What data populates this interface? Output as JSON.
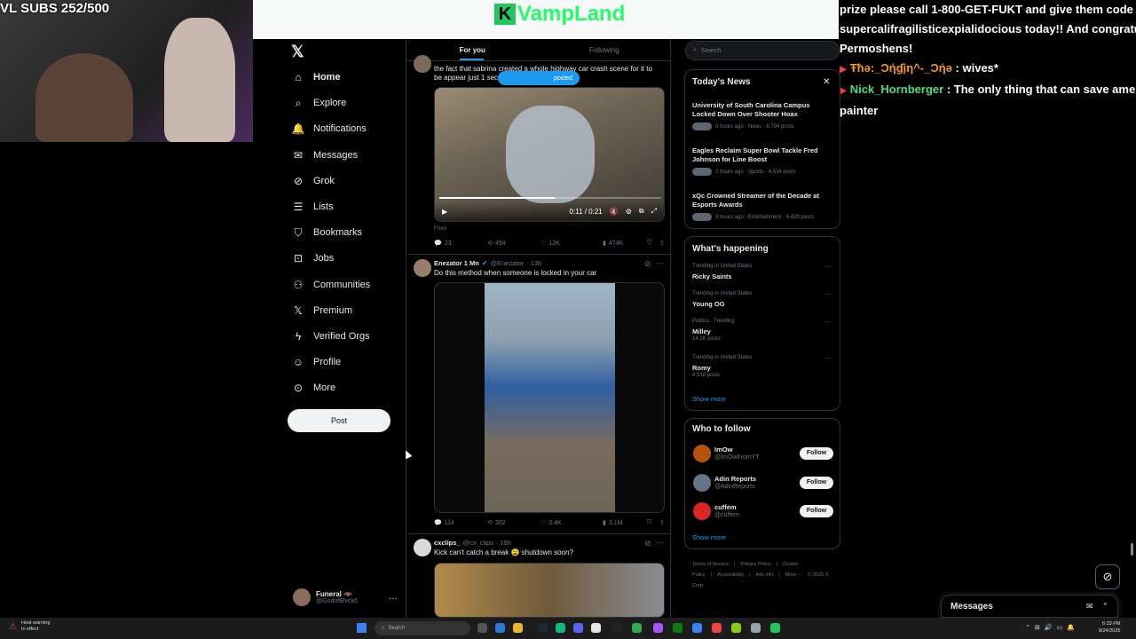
{
  "overlay": {
    "subs_counter": "VL SUBS 252/500",
    "brand_letter": "K",
    "brand_name": "VampLand",
    "chat": [
      {
        "user": "",
        "text": "prize please call 1-800-GET-FUKT and give them code"
      },
      {
        "user": "",
        "text": "supercalifragilisticexpialidocious today!! And congratulation"
      },
      {
        "user": "",
        "text": "Permoshens!"
      },
      {
        "user": "Ŧħə:_Ɔήɠįη^-_Ɔήə",
        "text": ": wives*"
      },
      {
        "user": "Nick_Hornberger",
        "text": ": The only thing that can save america i"
      },
      {
        "user": "",
        "text": "painter"
      }
    ]
  },
  "nav": {
    "logo": "𝕏",
    "items": [
      {
        "label": "Home",
        "icon": "home-icon",
        "glyph": "⌂"
      },
      {
        "label": "Explore",
        "icon": "search-icon",
        "glyph": "⌕"
      },
      {
        "label": "Notifications",
        "icon": "bell-icon",
        "glyph": "🔔"
      },
      {
        "label": "Messages",
        "icon": "mail-icon",
        "glyph": "✉"
      },
      {
        "label": "Grok",
        "icon": "grok-icon",
        "glyph": "⊘"
      },
      {
        "label": "Lists",
        "icon": "list-icon",
        "glyph": "☰"
      },
      {
        "label": "Bookmarks",
        "icon": "bookmark-icon",
        "glyph": "⛉"
      },
      {
        "label": "Jobs",
        "icon": "briefcase-icon",
        "glyph": "⊡"
      },
      {
        "label": "Communities",
        "icon": "people-icon",
        "glyph": "⚇"
      },
      {
        "label": "Premium",
        "icon": "x-icon",
        "glyph": "𝕏"
      },
      {
        "label": "Verified Orgs",
        "icon": "lightning-icon",
        "glyph": "ϟ"
      },
      {
        "label": "Profile",
        "icon": "person-icon",
        "glyph": "☺"
      },
      {
        "label": "More",
        "icon": "more-circle-icon",
        "glyph": "⊙"
      }
    ],
    "post_label": "Post",
    "account_name": "Funeral 🦇",
    "account_handle": "@GodofBlvck6",
    "account_more": "···"
  },
  "feed": {
    "tabs": [
      "For you",
      "Following"
    ],
    "tweet1": {
      "text": "the fact that sabrina created a whole highway car crash scene for it to be appear just 1 sec on t",
      "posted_pill": "posted",
      "video_time": "0:11 / 0:21",
      "video_progress_pct": 52,
      "from_label": "From",
      "replies": "23",
      "reposts": "454",
      "likes": "12K",
      "views": "474K"
    },
    "tweet2": {
      "name": "Enezator 1 Mn",
      "handle": "@Enezator",
      "time": "· 13h",
      "text": "Do this method when someone is locked in your car",
      "replies": "114",
      "reposts": "302",
      "likes": "3.4K",
      "views": "3.1M"
    },
    "tweet3": {
      "name": "cxclips_",
      "handle": "@cx_clips",
      "time": "· 18h",
      "text": "Kick can't catch a break 😩 shutdown soon?"
    }
  },
  "sidebar": {
    "search_placeholder": "Search",
    "news_title": "Today's News",
    "news": [
      {
        "title": "University of South Carolina Campus Locked Down Over Shooter Hoax",
        "meta": "3 hours ago · News · 6,794 posts"
      },
      {
        "title": "Eagles Reclaim Super Bowl Tackle Fred Johnson for Line Boost",
        "meta": "2 hours ago · Sports · 4,534 posts"
      },
      {
        "title": "xQc Crowned Streamer of the Decade at Esports Awards",
        "meta": "3 hours ago · Entertainment · 6,428 posts"
      }
    ],
    "happening_title": "What's happening",
    "trends": [
      {
        "category": "Trending in United States",
        "name": "Ricky Saints",
        "count": ""
      },
      {
        "category": "Trending in United States",
        "name": "Young OG",
        "count": ""
      },
      {
        "category": "Politics · Trending",
        "name": "Milley",
        "count": "14.1K posts"
      },
      {
        "category": "Trending in United States",
        "name": "Romy",
        "count": "4,518 posts"
      }
    ],
    "show_more": "Show more",
    "follow_title": "Who to follow",
    "follow": [
      {
        "name": "ImOw",
        "handle": "@ImOwFromYT",
        "button": "Follow"
      },
      {
        "name": "Adin Reports",
        "handle": "@AdinReports",
        "button": "Follow"
      },
      {
        "name": "cuffem",
        "handle": "@cuffem",
        "button": "Follow"
      }
    ],
    "footer": [
      "Terms of Service",
      "|",
      "Privacy Policy",
      "|",
      "Cookie Policy",
      "|",
      "Accessibility",
      "|",
      "Ads info",
      "|",
      "More ···",
      "© 2025 X Corp."
    ]
  },
  "messages_dock": {
    "title": "Messages"
  },
  "taskbar": {
    "weather_line1": "Heat warning",
    "weather_line2": "In effect",
    "search_placeholder": "Search",
    "time": "6:33 PM",
    "date": "8/24/2025"
  }
}
